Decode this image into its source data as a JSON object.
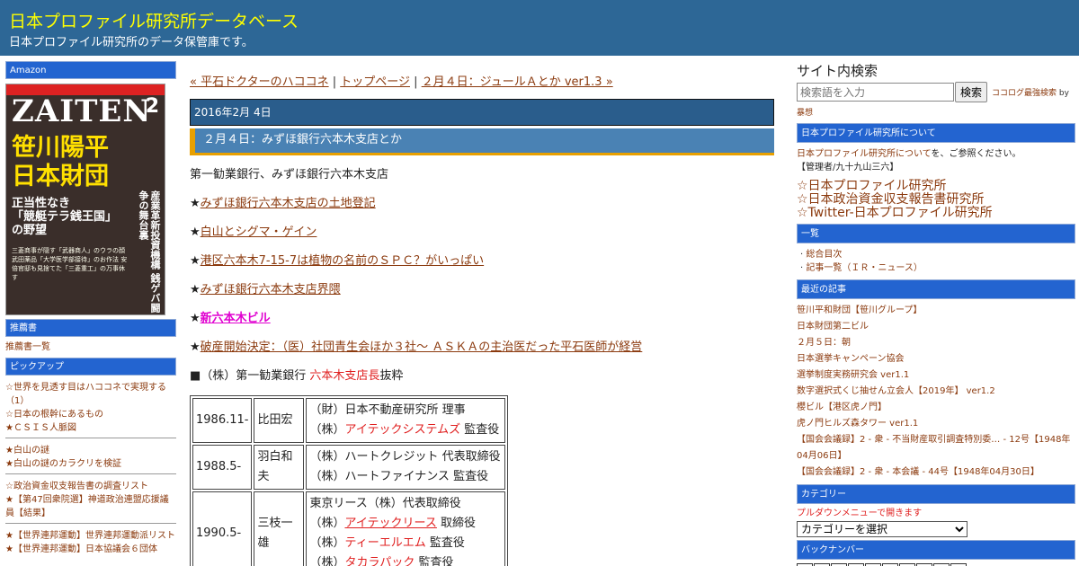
{
  "header": {
    "title": "日本プロファイル研究所データベース",
    "description": "日本プロファイル研究所のデータ保管庫です。"
  },
  "left": {
    "amazon_heading": "Amazon",
    "book": {
      "masthead": "ZAITEN",
      "issue": "2",
      "headline": "笹川陽平\n日本財団",
      "subhead": "正当性なき\n「競艇テラ銭王国」\nの野望",
      "vertical": "産業革新投資機構 銭ゲバ闘争の舞台裏",
      "small": "三菱商事が隠す「武器商人」のウラの顔 武田薬品「大学医学部接待」のお作法 安倍官邸も見捨てた「三菱重工」の万事休す"
    },
    "recommended_heading": "推薦書",
    "recommended_link": "推薦書一覧",
    "pickup_heading": "ピックアップ",
    "pickup_groups": [
      [
        "☆世界を見透す目はハココネで実現する（1）",
        "☆日本の根幹にあるもの",
        "★ＣＳＩＳ人脈図"
      ],
      [
        "★白山の謎",
        "★白山の謎のカラクリを検証"
      ],
      [
        "☆政治資金収支報告書の調査リスト",
        "★【第47回衆院選】神道政治連盟応援議員【結果】"
      ],
      [
        "★【世界連邦運動】世界連邦運動派リスト",
        "★【世界連邦運動】日本協議会６団体"
      ]
    ]
  },
  "main": {
    "nav": {
      "prev": "« 平石ドクターのハココネ",
      "sep1": " | ",
      "top": "トップページ",
      "sep2": " | ",
      "next": "２月４日：ジュールＡとか ver1.3 »"
    },
    "date": "2016年2月 4日",
    "post_title": "２月４日：みずほ銀行六本木支店とか",
    "intro": "第一勧業銀行、みずほ銀行六本木支店",
    "star_links": [
      "みずほ銀行六本木支店の土地登記",
      "白山とシグマ・ゲイン",
      "港区六本木7-15-7は植物の名前のＳＰＣ？がいっぱい",
      "みずほ銀行六本木支店界隈",
      "新六本木ビル",
      "破産開始決定：（医）社団青生会ほか３社～ ＡＳＫＡの主治医だった平石医師が経営"
    ],
    "excerpt": {
      "prefix": "■（株）第一勧業銀行 ",
      "highlight": "六本木支店長",
      "suffix": "抜粋"
    },
    "officers": [
      {
        "year": "1986.11-",
        "name": "比田宏",
        "roles": [
          {
            "pre": "（財）日本不動産研究所 理事",
            "link": "",
            "post": ""
          },
          {
            "pre": "（株）",
            "link": "アイテックシステムズ",
            "linked": false,
            "post": " 監査役"
          }
        ]
      },
      {
        "year": "1988.5-",
        "name": "羽白和夫",
        "roles": [
          {
            "pre": "（株）ハートクレジット 代表取締役",
            "link": "",
            "post": ""
          },
          {
            "pre": "（株）ハートファイナンス 監査役",
            "link": "",
            "post": ""
          }
        ]
      },
      {
        "year": "1990.5-",
        "name": "三枝一雄",
        "roles": [
          {
            "pre": "東京リース（株）代表取締役",
            "link": "",
            "post": ""
          },
          {
            "pre": "（株）",
            "link": "アイテックリース",
            "linked": true,
            "post": " 取締役"
          },
          {
            "pre": "（株）",
            "link": "ティーエルエム",
            "linked": false,
            "post": " 監査役"
          },
          {
            "pre": "（株）",
            "link": "タカラパック",
            "linked": true,
            "post": " 監査役"
          }
        ]
      }
    ]
  },
  "right": {
    "search_title": "サイト内検索",
    "search_placeholder": "検索語を入力",
    "search_button": "検索",
    "search_credit_link": "ココログ最強検索",
    "search_credit_by": " by",
    "search_credit_author": "暴想",
    "about_heading": "日本プロファイル研究所について",
    "about_link": "日本プロファイル研究所について",
    "about_text": "を、ご参照ください。",
    "admin": "【管理者/九十九山三六】",
    "big_links": [
      "☆日本プロファイル研究所",
      "☆日本政治資金収支報告書研究所",
      "☆Twitter-日本プロファイル研究所"
    ],
    "list_heading": "一覧",
    "list_items": [
      "総合目次",
      "記事一覧（ＩＲ・ニュース）"
    ],
    "recent_heading": "最近の記事",
    "recent_items": [
      "笹川平和財団【笹川グループ】",
      "日本財団第二ビル",
      "２月５日：朝",
      "日本選挙キャンペーン協会",
      "選挙制度実務研究会 ver1.1",
      "数字選択式くじ抽せん立会人【2019年】 ver1.2",
      "櫻ビル【港区虎ノ門】",
      "虎ノ門ヒルズ森タワー ver1.1",
      "【国会会議録】2 - 衆 - 不当財産取引調査特別委… - 12号【1948年04月06日】",
      "【国会会議録】2 - 衆 - 本会議 - 44号【1948年04月30日】"
    ],
    "category_heading": "カテゴリー",
    "category_note": "プルダウンメニューで開きます",
    "category_select": "カテゴリーを選択",
    "backnumber_heading": "バックナンバー"
  }
}
